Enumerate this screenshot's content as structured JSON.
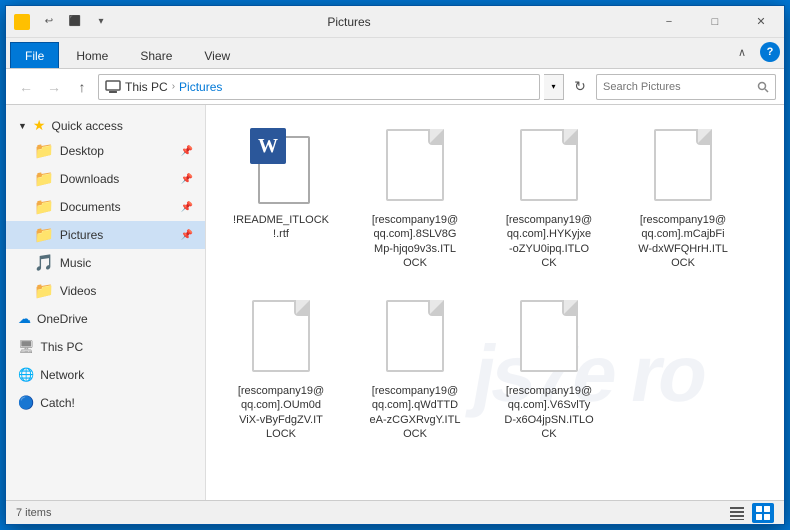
{
  "window": {
    "title": "Pictures",
    "minimize_label": "−",
    "maximize_label": "□",
    "close_label": "✕"
  },
  "ribbon": {
    "tabs": [
      "File",
      "Home",
      "Share",
      "View"
    ],
    "active_tab": "File"
  },
  "toolbar": {
    "back_label": "←",
    "forward_label": "→",
    "up_label": "↑",
    "dropdown_label": "▼",
    "refresh_label": "⟳"
  },
  "breadcrumb": {
    "items": [
      "This PC",
      "Pictures"
    ],
    "separator": "›"
  },
  "search": {
    "placeholder": "Search Pictures"
  },
  "sidebar": {
    "quick_access_label": "Quick access",
    "items": [
      {
        "label": "Desktop",
        "pinned": true
      },
      {
        "label": "Downloads",
        "pinned": true
      },
      {
        "label": "Documents",
        "pinned": true
      },
      {
        "label": "Pictures",
        "pinned": true,
        "active": true
      },
      {
        "label": "Music",
        "pinned": false
      },
      {
        "label": "Videos",
        "pinned": false
      }
    ],
    "onedrive_label": "OneDrive",
    "thispc_label": "This PC",
    "network_label": "Network",
    "catch_label": "Catch!"
  },
  "files": [
    {
      "name": "!README_ITLOCK!.rtf",
      "type": "word",
      "display_name": "!README_ITLOCK\n!.rtf"
    },
    {
      "name": "[rescompany19@qq.com].8SLV8GMp-hjqo9v3s.ITLOCK",
      "type": "generic",
      "display_name": "[rescompany19@\nqq.com].8SLV8G\nMp-hjqo9v3s.ITL\nOCK"
    },
    {
      "name": "[rescompany19@qq.com].HYKyjxe-oZYU0ipq.ITLOCK",
      "type": "generic",
      "display_name": "[rescompany19@\nqq.com].HYKyjxe\n-oZYU0ipq.ITLO\nCK"
    },
    {
      "name": "[rescompany19@qq.com].mCajbFiW-dxWFQHrH.ITLOCK",
      "type": "generic",
      "display_name": "[rescompany19@\nqq.com].mCajbFi\nW-dxWFQHrH.ITL\nOCK"
    },
    {
      "name": "[rescompany19@qq.com].OUm0dViX-vByFdgZV.ITLOCK",
      "type": "generic",
      "display_name": "[rescompany19@\nqq.com].OUm0d\nViX-vByFdgZV.IT\nLOCK"
    },
    {
      "name": "[rescompany19@qq.com].qWdTTDeA-zCGXRvgY.ITLOCK",
      "type": "generic",
      "display_name": "[rescompany19@\nqq.com].qWdTTD\neA-zCGXRvgY.ITL\nOCK"
    },
    {
      "name": "[rescompany19@qq.com].V6SvITyD-x6O4jpSN.ITLOCK",
      "type": "generic",
      "display_name": "[rescompany19@\nqq.com].V6SvlTy\nD-x6O4jpSN.ITLO\nCK"
    }
  ],
  "status_bar": {
    "item_count": "7 items"
  },
  "watermark_text": "js7e ro"
}
